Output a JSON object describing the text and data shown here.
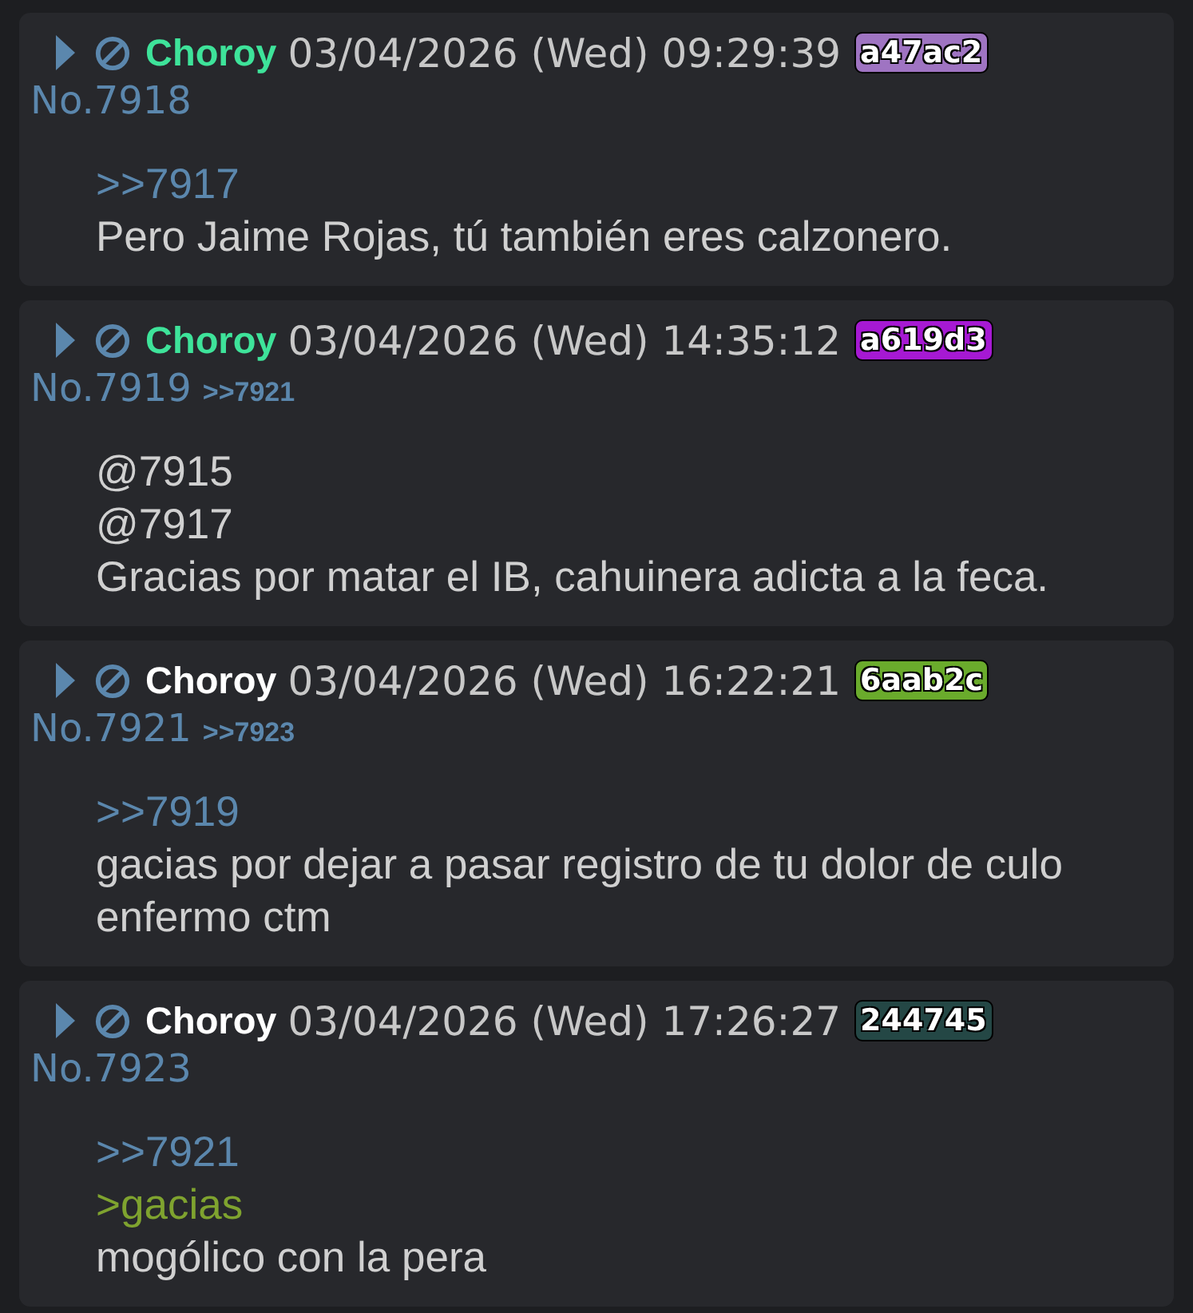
{
  "posts": [
    {
      "name": {
        "text": "Choroy",
        "color": "#3ee39a"
      },
      "date": "03/04/2026 (Wed) 09:29:39",
      "id": {
        "text": "a47ac2",
        "color": "#9f74c2"
      },
      "number": "No.7918",
      "body": [
        {
          "kind": "quote",
          "text": ">>7917"
        },
        {
          "kind": "text",
          "text": "Pero Jaime Rojas, tú también eres calzonero."
        }
      ]
    },
    {
      "name": {
        "text": "Choroy",
        "color": "#3ee39a"
      },
      "date": "03/04/2026 (Wed) 14:35:12",
      "id": {
        "text": "a619d3",
        "color": "#a619d3"
      },
      "number": "No.7919",
      "backlinks": [
        ">>7921"
      ],
      "body": [
        {
          "kind": "text",
          "text": "@7915"
        },
        {
          "kind": "text",
          "text": "@7917"
        },
        {
          "kind": "text",
          "text": "Gracias por matar el IB, cahuinera adicta a la feca."
        }
      ]
    },
    {
      "name": {
        "text": "Choroy",
        "color": "#ffffff"
      },
      "date": "03/04/2026 (Wed) 16:22:21",
      "id": {
        "text": "6aab2c",
        "color": "#6aab2c"
      },
      "number": "No.7921",
      "backlinks": [
        ">>7923"
      ],
      "body": [
        {
          "kind": "quote",
          "text": ">>7919"
        },
        {
          "kind": "text",
          "text": "gacias por dejar a pasar registro de tu dolor de culo enfermo ctm"
        }
      ]
    },
    {
      "name": {
        "text": "Choroy",
        "color": "#ffffff"
      },
      "date": "03/04/2026 (Wed) 17:26:27",
      "id": {
        "text": "244745",
        "color": "#244745"
      },
      "number": "No.7923",
      "body": [
        {
          "kind": "quote",
          "text": ">>7921"
        },
        {
          "kind": "greentext",
          "text": ">gacias"
        },
        {
          "kind": "text",
          "text": "mogólico con la pera"
        }
      ]
    }
  ]
}
